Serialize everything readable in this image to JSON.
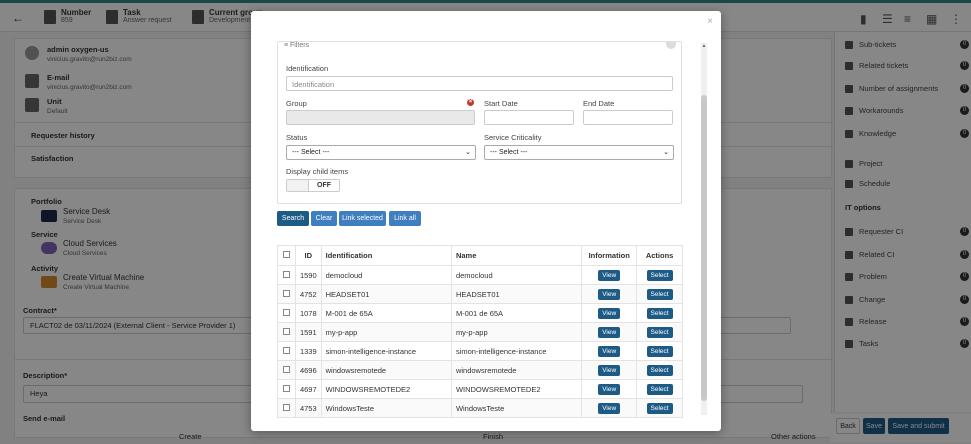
{
  "topbar": {
    "number_label": "Number",
    "number_value": "859",
    "task_label": "Task",
    "task_value": "Answer request",
    "group_label": "Current group",
    "group_value": "Development",
    "notif_count": "0"
  },
  "requester": {
    "name": "admin oxygen-us",
    "email_inline": "vinicius.gravito@run2biz.com",
    "email_label": "E-mail",
    "email_value": "vinicius.gravito@run2biz.com",
    "unit_label": "Unit",
    "unit_value": "Default"
  },
  "sections": {
    "requester_history": "Requester history",
    "satisfaction": "Satisfaction",
    "portfolio_label": "Portfolio",
    "portfolio_value": "Service Desk",
    "portfolio_sub": "Service Desk",
    "service_label": "Service",
    "service_value": "Cloud Services",
    "service_sub": "Cloud Services",
    "activity_label": "Activity",
    "activity_value": "Create Virtual Machine",
    "activity_sub": "Create Virtual Machine",
    "contract_label": "Contract*",
    "contract_value": "FLACT02 de 03/11/2024 (External Client - Service Provider 1)",
    "description_label": "Description*",
    "description_value": "Heya",
    "send_email_label": "Send e-mail",
    "create_label": "Create",
    "finish_label": "Finish",
    "other_actions_label": "Other actions"
  },
  "right_panel": {
    "items": [
      {
        "label": "Sub-tickets",
        "count": "0"
      },
      {
        "label": "Related tickets",
        "count": "0"
      },
      {
        "label": "Number of assignments",
        "count": "0"
      },
      {
        "label": "Workarounds",
        "count": "0"
      },
      {
        "label": "Knowledge",
        "count": "0"
      },
      {
        "label": "Project",
        "count": ""
      },
      {
        "label": "Schedule",
        "count": ""
      }
    ],
    "it_options_label": "IT options",
    "it_items": [
      {
        "label": "Requester CI",
        "count": "0"
      },
      {
        "label": "Related CI",
        "count": "0"
      },
      {
        "label": "Problem",
        "count": "0"
      },
      {
        "label": "Change",
        "count": "0"
      },
      {
        "label": "Release",
        "count": "0"
      },
      {
        "label": "Tasks",
        "count": "0"
      }
    ]
  },
  "bottom_actions": {
    "back": "Back",
    "save": "Save",
    "save_submit": "Save and submit"
  },
  "modal": {
    "close_glyph": "×",
    "filters_title": "Filters",
    "identification_label": "Identification",
    "identification_placeholder": "Identification",
    "group_label": "Group",
    "start_date_label": "Start Date",
    "end_date_label": "End Date",
    "status_label": "Status",
    "status_value": "--- Select ---",
    "criticality_label": "Service Criticality",
    "criticality_value": "--- Select ---",
    "display_child_label": "Display child items",
    "toggle_value": "OFF",
    "buttons": {
      "search": "Search",
      "clear": "Clear",
      "link_selected": "Link selected",
      "link_all": "Link all"
    },
    "table": {
      "headers": [
        "ID",
        "Identification",
        "Name",
        "Information",
        "Actions"
      ],
      "view_label": "View",
      "select_label": "Select",
      "rows": [
        {
          "id": "1590",
          "identification": "democloud",
          "name": "democloud"
        },
        {
          "id": "4752",
          "identification": "HEADSET01",
          "name": "HEADSET01"
        },
        {
          "id": "1078",
          "identification": "M-001 de 65A",
          "name": "M-001 de 65A"
        },
        {
          "id": "1591",
          "identification": "my-p-app",
          "name": "my-p-app"
        },
        {
          "id": "1339",
          "identification": "simon-intelligence-instance",
          "name": "simon-intelligence-instance"
        },
        {
          "id": "4696",
          "identification": "windowsremotede",
          "name": "windowsremotede"
        },
        {
          "id": "4697",
          "identification": "WINDOWSREMOTEDE2",
          "name": "WINDOWSREMOTEDE2"
        },
        {
          "id": "4753",
          "identification": "WindowsTeste",
          "name": "WindowsTeste"
        }
      ]
    }
  },
  "colors": {
    "primary_button": "#1d5b86",
    "secondary_button": "#3f7fbf",
    "accent_bar": "#2e8b8b",
    "error_icon": "#c0392b"
  }
}
